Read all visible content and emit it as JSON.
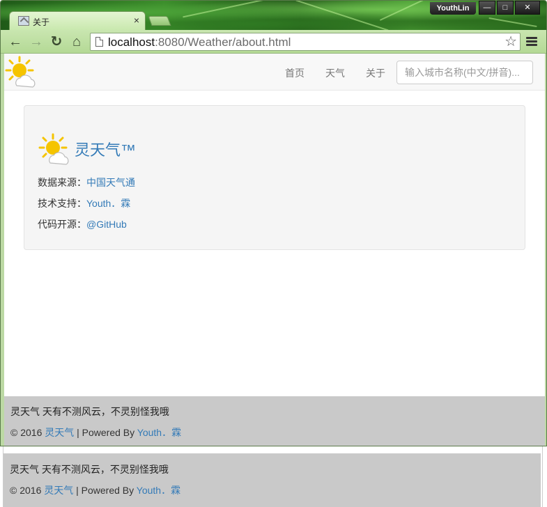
{
  "browser": {
    "tab_title": "关于",
    "tab_close": "×",
    "user_name": "YouthLin",
    "window_buttons": {
      "minimize": "—",
      "maximize": "□",
      "close": "✕"
    },
    "nav": {
      "back": "←",
      "forward": "→",
      "reload": "↻",
      "home": "⌂"
    },
    "url_host": "localhost",
    "url_rest": ":8080/Weather/about.html",
    "star": "☆",
    "icons": {
      "tab_favicon": "image-file-icon",
      "page": "page-icon",
      "star": "bookmark-star-icon",
      "menu": "menu-icon"
    }
  },
  "navbar": {
    "links": [
      "首页",
      "天气",
      "关于"
    ],
    "search_placeholder": "输入城市名称(中文/拼音)..."
  },
  "about": {
    "title": "灵天气™",
    "source_label": "数据来源：",
    "source_link": "中国天气通",
    "support_label": "技术支持：",
    "support_link": "Youth．霖",
    "opensource_label": "代码开源：",
    "opensource_link": "@GitHub"
  },
  "footer": {
    "tagline": "灵天气 天有不测风云，不灵别怪我哦",
    "copyright_prefix": "© 2016 ",
    "brand_link": "灵天气",
    "powered_by": " | Powered By ",
    "author_link": "Youth．霖"
  },
  "colors": {
    "link": "#337ab7",
    "navbar_bg": "#f8f8f8",
    "well_bg": "#f5f5f5",
    "footer_bg": "#c9c9c9",
    "sun": "#f5c400",
    "browser_toolbar": "#c9e6b0"
  }
}
